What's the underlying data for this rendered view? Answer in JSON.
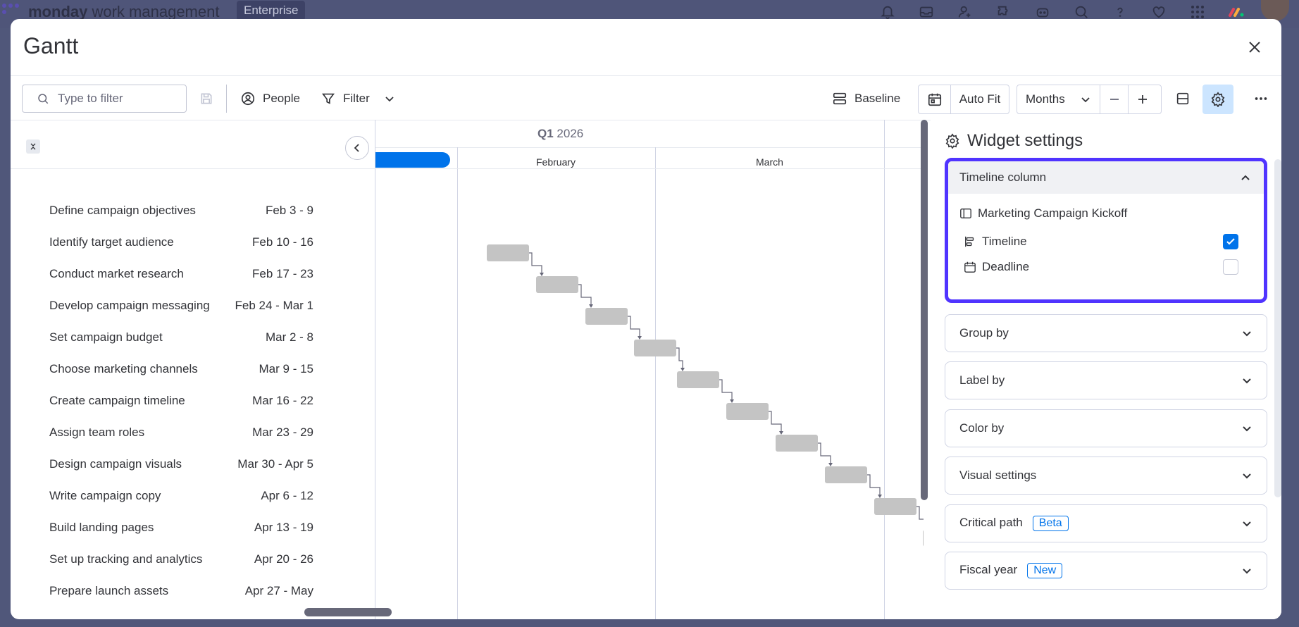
{
  "app": {
    "brand_bold": "monday",
    "brand_light": "work management",
    "plan_badge": "Enterprise"
  },
  "modal": {
    "title": "Gantt"
  },
  "toolbar": {
    "search_placeholder": "Type to filter",
    "people_label": "People",
    "filter_label": "Filter",
    "baseline_label": "Baseline",
    "autofit_label": "Auto Fit",
    "zoom_label": "Months"
  },
  "gantt": {
    "quarter_bold": "Q1",
    "quarter_year": "2026",
    "months": [
      "February",
      "March"
    ]
  },
  "tasks": [
    {
      "name": "Define campaign objectives",
      "date": "Feb 3 - 9"
    },
    {
      "name": "Identify target audience",
      "date": "Feb 10 - 16"
    },
    {
      "name": "Conduct market research",
      "date": "Feb 17 - 23"
    },
    {
      "name": "Develop campaign messaging",
      "date": "Feb 24 - Mar 1"
    },
    {
      "name": "Set campaign budget",
      "date": "Mar 2 - 8"
    },
    {
      "name": "Choose marketing channels",
      "date": "Mar 9 - 15"
    },
    {
      "name": "Create campaign timeline",
      "date": "Mar 16 - 22"
    },
    {
      "name": "Assign team roles",
      "date": "Mar 23 - 29"
    },
    {
      "name": "Design campaign visuals",
      "date": "Mar 30 - Apr 5"
    },
    {
      "name": "Write campaign copy",
      "date": "Apr 6 - 12"
    },
    {
      "name": "Build landing pages",
      "date": "Apr 13 - 19"
    },
    {
      "name": "Set up tracking and analytics",
      "date": "Apr 20 - 26"
    },
    {
      "name": "Prepare launch assets",
      "date": "Apr 27 - May"
    }
  ],
  "widget_settings": {
    "title": "Widget settings",
    "timeline_column": {
      "header": "Timeline column",
      "board_name": "Marketing Campaign Kickoff",
      "options": [
        {
          "label": "Timeline",
          "checked": true
        },
        {
          "label": "Deadline",
          "checked": false
        }
      ]
    },
    "sections": [
      {
        "label": "Group by",
        "tag": ""
      },
      {
        "label": "Label by",
        "tag": ""
      },
      {
        "label": "Color by",
        "tag": ""
      },
      {
        "label": "Visual settings",
        "tag": ""
      },
      {
        "label": "Critical path",
        "tag": "Beta"
      },
      {
        "label": "Fiscal year",
        "tag": "New"
      }
    ]
  },
  "colors": {
    "accent_blue": "#0073ea",
    "focus_ring": "#5034ff",
    "bar_gray": "#c4c4c4",
    "settings_active_bg": "#cce5ff"
  }
}
